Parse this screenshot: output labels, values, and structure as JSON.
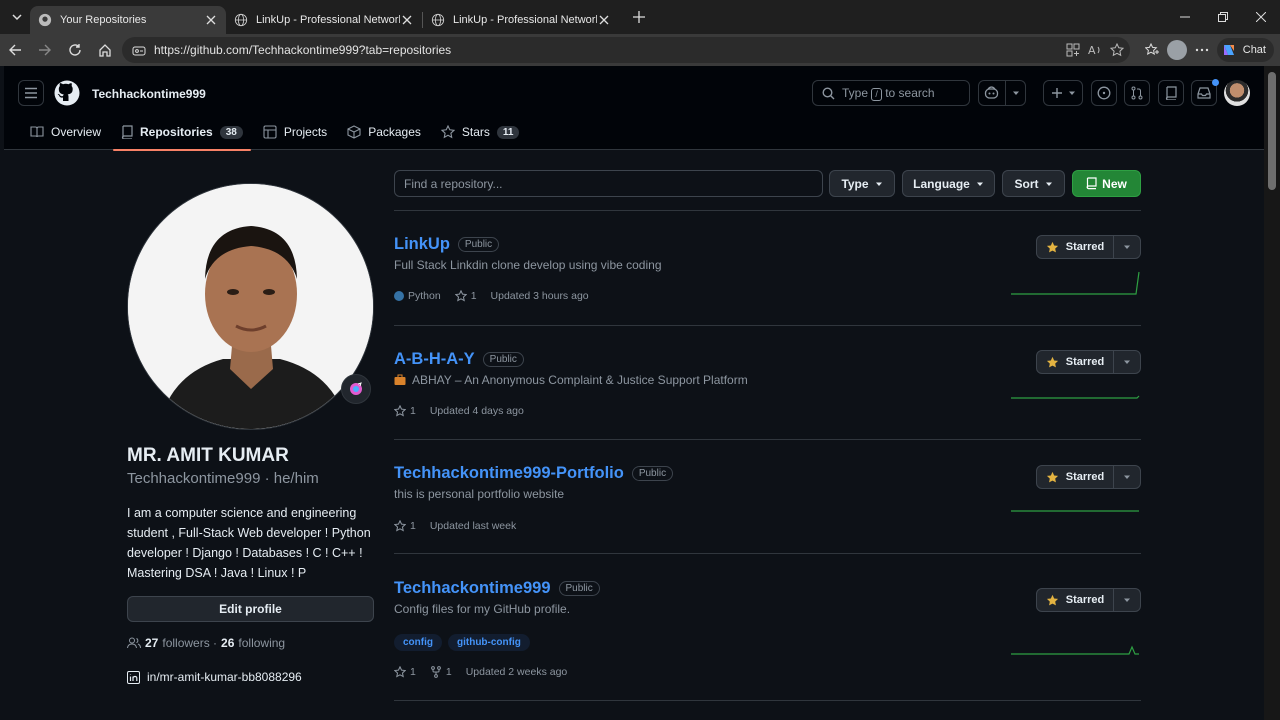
{
  "browser": {
    "tabs": [
      {
        "title": "Your Repositories",
        "active": true
      },
      {
        "title": "LinkUp - Professional Network",
        "active": false
      },
      {
        "title": "LinkUp - Professional Network",
        "active": false
      }
    ],
    "url": "https://github.com/Techhackontime999?tab=repositories",
    "chat_label": "Chat"
  },
  "header": {
    "username": "Techhackontime999",
    "search_prefix": "Type",
    "search_key": "/",
    "search_suffix": "to search"
  },
  "nav": {
    "overview": "Overview",
    "repositories": "Repositories",
    "repositories_count": "38",
    "projects": "Projects",
    "packages": "Packages",
    "stars": "Stars",
    "stars_count": "11"
  },
  "profile": {
    "name": "MR. AMIT KUMAR",
    "login_line": "Techhackontime999 · he/him",
    "bio": "I am a computer science and engineering student , Full-Stack Web developer ! Python developer ! Django ! Databases ! C ! C++ ! Mastering DSA ! Java ! Linux ! P",
    "edit_label": "Edit profile",
    "followers_count": "27",
    "followers_label": "followers ·",
    "following_count": "26",
    "following_label": "following",
    "linkedin": "in/mr-amit-kumar-bb8088296"
  },
  "filters": {
    "search_placeholder": "Find a repository...",
    "type_label": "Type",
    "language_label": "Language",
    "sort_label": "Sort",
    "new_label": "New"
  },
  "repos": [
    {
      "name": "LinkUp",
      "visibility": "Public",
      "description": "Full Stack Linkdin clone develop using vibe coding",
      "language": "Python",
      "stars": "1",
      "updated": "Updated 3 hours ago",
      "star_label": "Starred"
    },
    {
      "name": "A-B-H-A-Y",
      "visibility": "Public",
      "description": "ABHAY – An Anonymous Complaint & Justice Support Platform",
      "stars": "1",
      "updated": "Updated 4 days ago",
      "star_label": "Starred"
    },
    {
      "name": "Techhackontime999-Portfolio",
      "visibility": "Public",
      "description": "this is personal portfolio website",
      "stars": "1",
      "updated": "Updated last week",
      "star_label": "Starred"
    },
    {
      "name": "Techhackontime999",
      "visibility": "Public",
      "description": "Config files for my GitHub profile.",
      "topics": [
        "config",
        "github-config"
      ],
      "stars": "1",
      "forks": "1",
      "updated": "Updated 2 weeks ago",
      "star_label": "Starred"
    }
  ],
  "colors": {
    "accent": "#4493f8",
    "primary": "#238636",
    "tab_underline": "#f78166",
    "star": "#e3b341",
    "spark": "#2ea043"
  }
}
